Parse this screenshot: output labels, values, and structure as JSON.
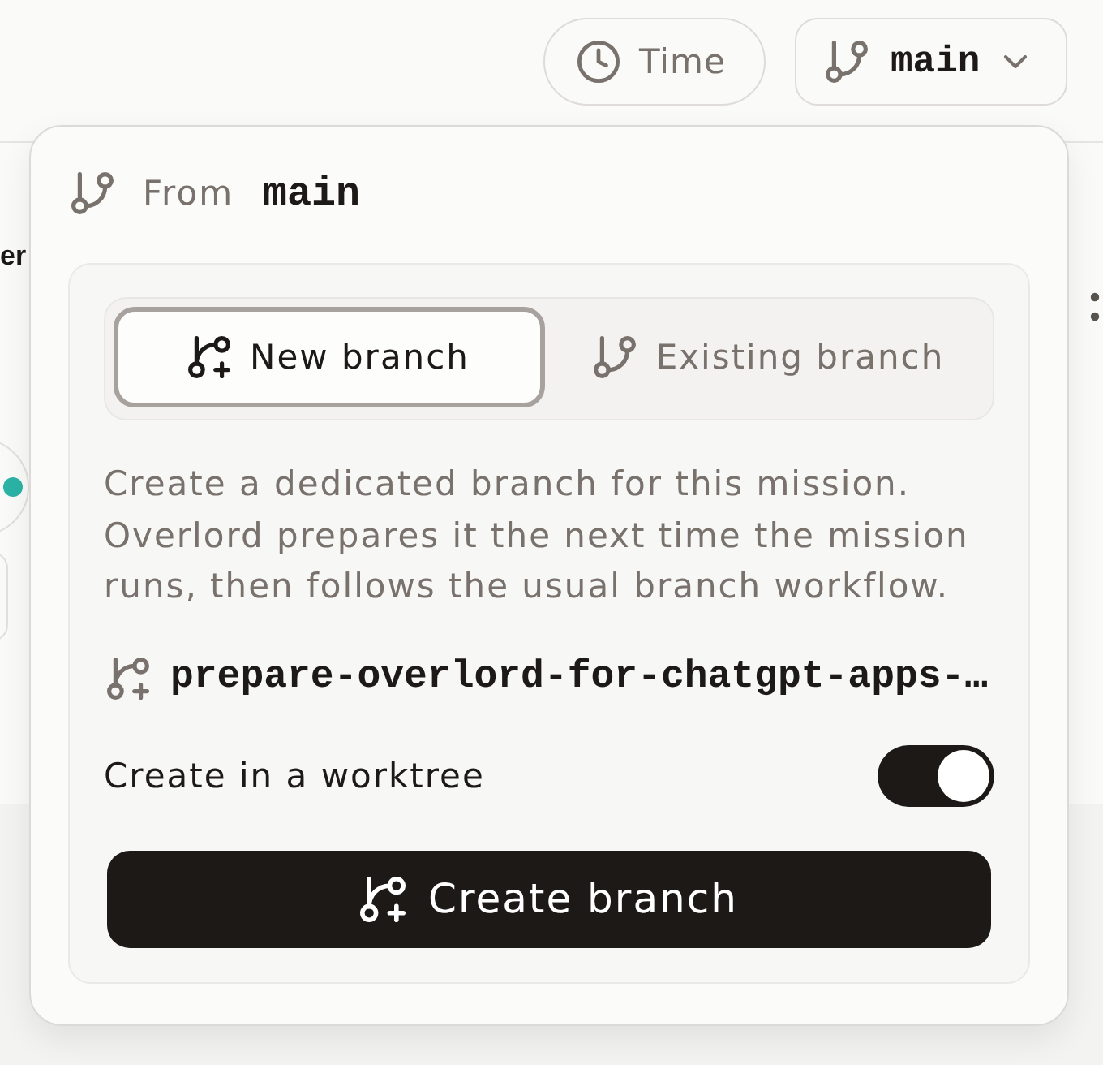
{
  "toolbar": {
    "time_button": {
      "label": "Time"
    },
    "branch_button": {
      "label": "main"
    }
  },
  "background": {
    "heading_fragment": "er"
  },
  "popover": {
    "from_label": "From",
    "from_branch": "main",
    "tabs": [
      {
        "kind": "new",
        "label": "New branch",
        "selected": true
      },
      {
        "kind": "existing",
        "label": "Existing branch",
        "selected": false
      }
    ],
    "description": "Create a dedicated branch for this mission. Overlord prepares it the next time the mission runs, then follows the usual branch workflow.",
    "branch_name": "prepare-overlord-for-chatgpt-apps-…",
    "worktree": {
      "label": "Create in a worktree",
      "on": true
    },
    "submit": {
      "label": "Create branch"
    }
  }
}
